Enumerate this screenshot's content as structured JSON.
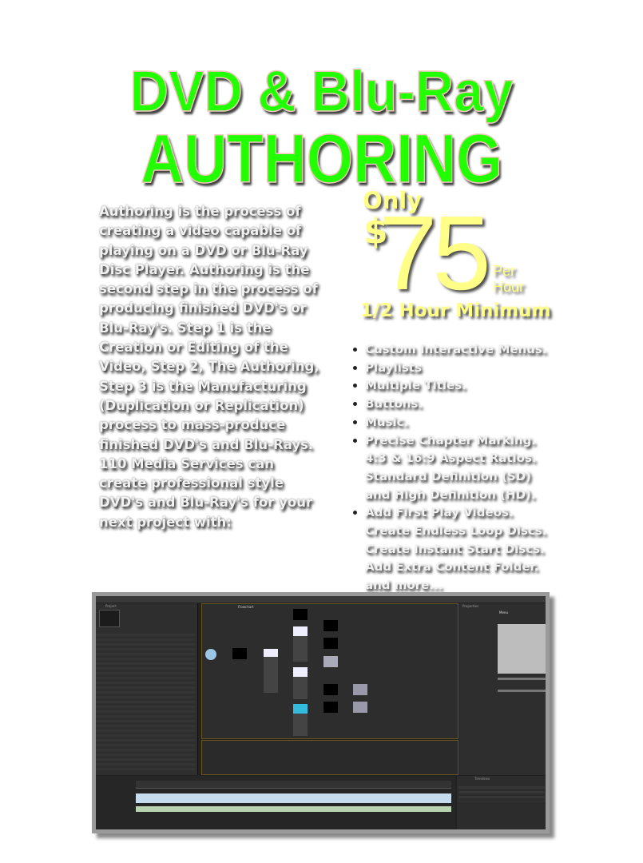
{
  "title": {
    "line1": "DVD & Blu-Ray",
    "line2": "AUTHORING"
  },
  "description_lines": [
    "Authoring is the process of",
    "creating a video capable of",
    "playing on a DVD or Blu-Ray",
    "Disc Player. Authoring is the",
    "second step in the process of",
    "producing finished DVD's or",
    "Blu-Ray's. Step 1 is the",
    "Creation or Editing of the",
    "Video, Step 2, The Authoring,",
    "Step 3 is the Manufacturing",
    "(Duplication or Replication)",
    "process to mass-produce",
    "finished DVD's and Blu-Rays.",
    "110 Media Services can",
    "create professional style",
    "DVD's and Blu-Ray's for your",
    "next project with:"
  ],
  "pricing": {
    "only": "Only",
    "currency": "$",
    "amount": "75",
    "per": "Per",
    "unit": "Hour",
    "minimum": "1/2 Hour Minimum"
  },
  "features": [
    [
      "Custom Interactive Menus."
    ],
    [
      "Playlists"
    ],
    [
      "Multiple Titles."
    ],
    [
      "Buttons."
    ],
    [
      "Music."
    ],
    [
      "Precise Chapter Marking.",
      "4:3 & 16:9 Aspect Ratios.",
      "Standard Definition (SD)",
      "and High Definition (HD)."
    ],
    [
      "Add First Play Videos.",
      "Create Endless Loop Discs.",
      "Create Instant Start Discs.",
      "Add Extra Content Folder.",
      "and more..."
    ]
  ],
  "software_screenshot": {
    "tabs": [
      "Project",
      "Flowchart",
      "Properties",
      "Menu",
      "Timelines"
    ]
  },
  "colors": {
    "title_green": "#22ff00",
    "price_yellow": "#ffff88",
    "app_bg": "#2b2b2b"
  }
}
